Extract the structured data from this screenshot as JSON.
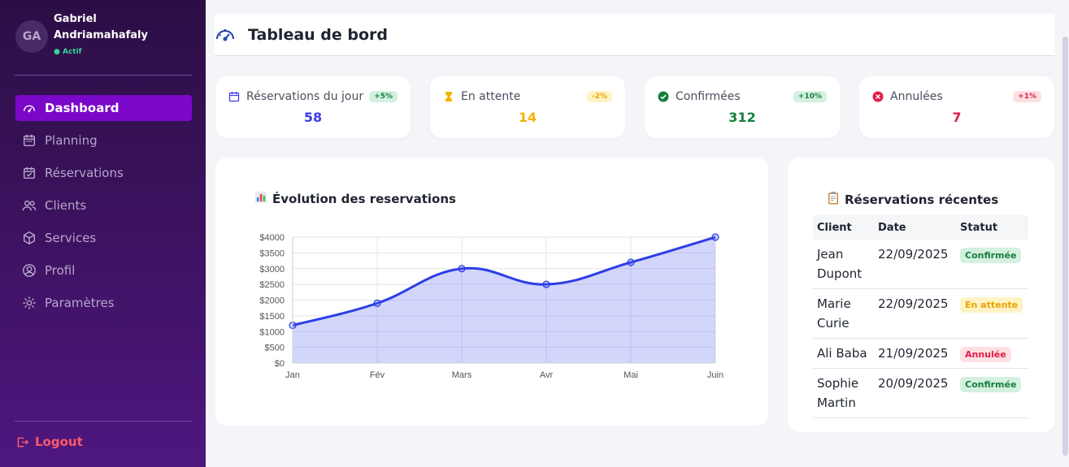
{
  "user": {
    "initials": "GA",
    "name": "Gabriel Andriamahafaly",
    "status": "● Actif"
  },
  "nav": [
    {
      "label": "Dashboard",
      "icon": "dashboard-icon",
      "active": true
    },
    {
      "label": "Planning",
      "icon": "calendar-icon"
    },
    {
      "label": "Réservations",
      "icon": "calendar-check-icon"
    },
    {
      "label": "Clients",
      "icon": "users-icon"
    },
    {
      "label": "Services",
      "icon": "box-icon"
    },
    {
      "label": "Profil",
      "icon": "user-circle-icon"
    },
    {
      "label": "Paramètres",
      "icon": "gear-icon"
    }
  ],
  "logout": "Logout",
  "header": {
    "title": "Tableau de bord"
  },
  "stats": [
    {
      "label": "Réservations du jour",
      "badge": "+5%",
      "value": "58",
      "color": "#3b3de8"
    },
    {
      "label": "En attente",
      "badge": "-2%",
      "value": "14",
      "color": "#f5b400"
    },
    {
      "label": "Confirmées",
      "badge": "+10%",
      "value": "312",
      "color": "#15803d"
    },
    {
      "label": "Annulées",
      "badge": "+1%",
      "value": "7",
      "color": "#e11d48"
    }
  ],
  "chart_title": "Évolution des reservations",
  "chart_data": {
    "type": "area",
    "categories": [
      "Jan",
      "Fév",
      "Mars",
      "Avr",
      "Mai",
      "Juin"
    ],
    "series": [
      {
        "values": [
          1200,
          1900,
          3000,
          2500,
          3200,
          4000
        ]
      }
    ],
    "ylim": [
      0,
      4000
    ],
    "yticks": [
      "$0",
      "$500",
      "$1000",
      "$1500",
      "$2000",
      "$2500",
      "$3000",
      "$3500",
      "$4000"
    ],
    "grid": true,
    "color": "#2c3ee6"
  },
  "recent": {
    "title": "Réservations récentes",
    "headers": [
      "Client",
      "Date",
      "Statut"
    ],
    "rows": [
      {
        "client": "Jean Dupont",
        "date": "22/09/2025",
        "status": "Confirmée"
      },
      {
        "client": "Marie Curie",
        "date": "22/09/2025",
        "status": "En attente"
      },
      {
        "client": "Ali Baba",
        "date": "21/09/2025",
        "status": "Annulée"
      },
      {
        "client": "Sophie Martin",
        "date": "20/09/2025",
        "status": "Confirmée"
      }
    ]
  }
}
